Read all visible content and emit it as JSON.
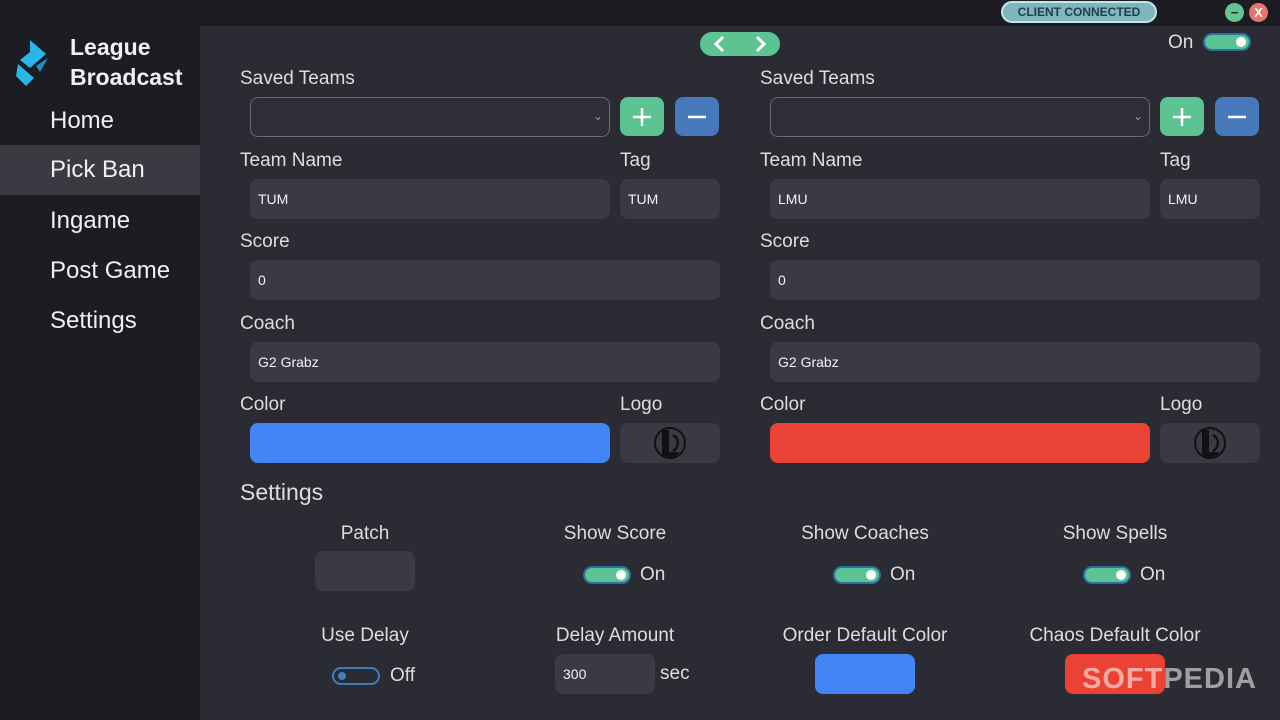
{
  "window": {
    "status_badge": "CLIENT CONNECTED",
    "minimize_glyph": "−",
    "close_glyph": "X"
  },
  "sidebar": {
    "brand_line1": "League",
    "brand_line2": "Broadcast",
    "items": [
      {
        "label": "Home",
        "active": false
      },
      {
        "label": "Pick Ban",
        "active": true
      },
      {
        "label": "Ingame",
        "active": false
      },
      {
        "label": "Post Game",
        "active": false
      },
      {
        "label": "Settings",
        "active": false
      }
    ]
  },
  "top": {
    "master_toggle_label": "On",
    "master_toggle_on": true
  },
  "teams": [
    {
      "saved_teams_label": "Saved Teams",
      "saved_teams_value": "",
      "team_name_label": "Team Name",
      "team_name_value": "TUM",
      "tag_label": "Tag",
      "tag_value": "TUM",
      "score_label": "Score",
      "score_value": "0",
      "coach_label": "Coach",
      "coach_value": "G2 Grabz",
      "color_label": "Color",
      "color_value": "#4285f4",
      "logo_label": "Logo",
      "logo_icon": "league-logo-icon"
    },
    {
      "saved_teams_label": "Saved Teams",
      "saved_teams_value": "",
      "team_name_label": "Team Name",
      "team_name_value": "LMU",
      "tag_label": "Tag",
      "tag_value": "LMU",
      "score_label": "Score",
      "score_value": "0",
      "coach_label": "Coach",
      "coach_value": "G2 Grabz",
      "color_label": "Color",
      "color_value": "#ea4335",
      "logo_label": "Logo",
      "logo_icon": "league-logo-icon"
    }
  ],
  "settings": {
    "title": "Settings",
    "patch_label": "Patch",
    "patch_value": "",
    "show_score_label": "Show Score",
    "show_score_state": "On",
    "show_coaches_label": "Show Coaches",
    "show_coaches_state": "On",
    "show_spells_label": "Show Spells",
    "show_spells_state": "On",
    "use_delay_label": "Use Delay",
    "use_delay_state": "Off",
    "delay_amount_label": "Delay Amount",
    "delay_amount_value": "300",
    "delay_unit": "sec",
    "order_color_label": "Order Default Color",
    "order_color_value": "#4285f4",
    "chaos_color_label": "Chaos Default Color",
    "chaos_color_value": "#ea4335"
  },
  "watermark": "SOFTPEDIA",
  "colors": {
    "accent_green": "#5cc493",
    "accent_blue": "#4579bb",
    "background": "#2b2b33",
    "sidebar": "#1c1c22"
  }
}
